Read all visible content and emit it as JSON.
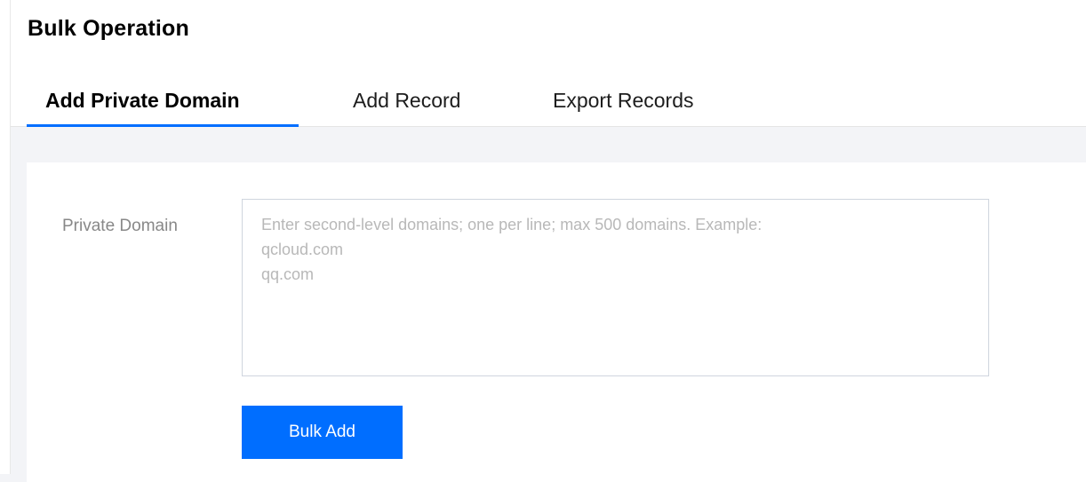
{
  "page": {
    "title": "Bulk Operation"
  },
  "tabs": [
    {
      "label": "Add Private Domain",
      "active": true
    },
    {
      "label": "Add Record",
      "active": false
    },
    {
      "label": "Export Records",
      "active": false
    }
  ],
  "form": {
    "private_domain_label": "Private Domain",
    "private_domain_value": "",
    "private_domain_placeholder": "Enter second-level domains; one per line; max 500 domains. Example:\nqcloud.com\nqq.com",
    "submit_label": "Bulk Add"
  },
  "colors": {
    "accent": "#006eff",
    "background": "#f3f4f7"
  }
}
